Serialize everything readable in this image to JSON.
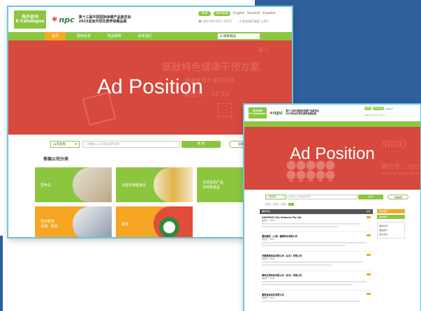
{
  "site": {
    "logo_line1": "电子会刊",
    "logo_line2": "E-Catalogue",
    "npc_brand": "npc",
    "expo_title_line1": "第十三届中国国际保健产品展览会",
    "expo_title_line2": "2023亚洲天然及营养保健品展",
    "header_buttons": [
      "登录",
      "预约观展"
    ],
    "languages": [
      "English",
      "Deutsch",
      "Español"
    ],
    "contact_phone": "400-876-5211  13517",
    "contact_email": "联系我们参展 (+86)"
  },
  "nav": {
    "items": [
      "首页",
      "展商名单",
      "新品推荐",
      "联系我们"
    ],
    "search_label": "Q 搜索展品"
  },
  "banner": {
    "ad_label": "Ad Position",
    "ghost_line1": "氨肽特色健康干预方案",
    "ghost_line2": "·健康管理方案提供商",
    "ghost_line3": "展位号：3E85",
    "ghost_logo": "家人"
  },
  "card2_banner": {
    "ad_label": "Ad Position",
    "ghost_line1": "展位号：3D29",
    "ghost_line2": "Booth Number: 3D29",
    "ghost_logo": "SIRIO"
  },
  "search": {
    "select_value": "公司名称",
    "placeholder": "请输入公司或品牌名称",
    "button_label": "搜 索",
    "category_button": "分类检索"
  },
  "categories": {
    "title": "参展公司分类",
    "items": [
      "营养品",
      "功能性保健食品",
      "天然有机产品\n及特殊食品",
      "营养教育\n咨询、服务",
      "其他"
    ],
    "colors": [
      "#8cc63f",
      "#8cc63f",
      "#8cc63f",
      "#f6a623",
      "#f6a623"
    ]
  },
  "list": {
    "header": "展商列表",
    "count": "总计",
    "side_buttons": [
      "预约展商",
      "展商搜索"
    ],
    "side_links": [
      "展商名录",
      "展品信息",
      "会议活动"
    ],
    "companies": [
      {
        "name": "AOHYNCH Life Sciences Pty Ltd",
        "booth": "展位号：3E46"
      },
      {
        "name": "澳际集团（上海）健康科技有限公司",
        "booth": "展位号：3E17"
      },
      {
        "name": "安徽泰源食品有限公司（山东）有限公司",
        "booth": "展位号：3E40"
      },
      {
        "name": "博林生物科技有限公司（河北）有限公司",
        "booth": "展位号：3F04"
      },
      {
        "name": "康恩食品科技有限公司",
        "booth": "展位号：3F21"
      }
    ]
  }
}
